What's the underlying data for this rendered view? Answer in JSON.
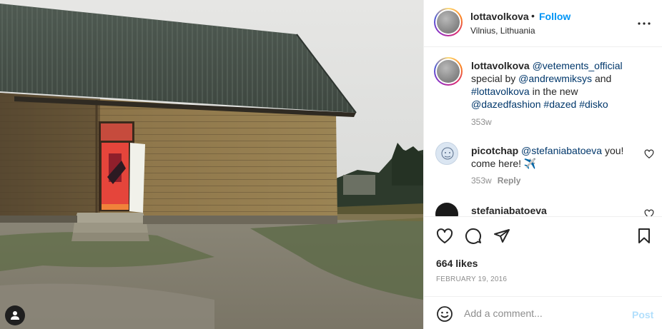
{
  "post": {
    "image": "wooden-house-photo",
    "header": {
      "username": "lottavolkova",
      "separator": "•",
      "follow_label": "Follow",
      "location": "Vilnius, Lithuania",
      "more_icon": "more-horizontal-icon"
    },
    "caption": {
      "username": "lottavolkova",
      "parts": [
        {
          "text": "@vetements_official",
          "link": true
        },
        {
          "text": " special by ",
          "link": false
        },
        {
          "text": "@andrewmiksys",
          "link": true
        },
        {
          "text": " and ",
          "link": false
        },
        {
          "text": "#lottavolkova",
          "link": true
        },
        {
          "text": " in the new ",
          "link": false
        },
        {
          "text": "@dazedfashion",
          "link": true
        },
        {
          "text": " ",
          "link": false
        },
        {
          "text": "#dazed",
          "link": true
        },
        {
          "text": " ",
          "link": false
        },
        {
          "text": "#disko",
          "link": true
        }
      ],
      "time": "353w"
    },
    "comments": [
      {
        "username": "picotchap",
        "mention": "@stefaniabatoeva",
        "text": " you! come here! ✈️",
        "time": "353w",
        "reply_label": "Reply"
      },
      {
        "username": "stefaniabatoeva"
      }
    ],
    "actions": {
      "like_icon": "heart-icon",
      "comment_icon": "comment-icon",
      "share_icon": "share-icon",
      "save_icon": "bookmark-icon"
    },
    "likes": "664 likes",
    "date": "FEBRUARY 19, 2016",
    "add_comment": {
      "placeholder": "Add a comment...",
      "post_label": "Post",
      "emoji_icon": "emoji-icon"
    }
  },
  "colors": {
    "follow": "#0095f6",
    "link": "#00376b",
    "muted": "#8e8e8e",
    "post_disabled": "#b2dffc"
  }
}
